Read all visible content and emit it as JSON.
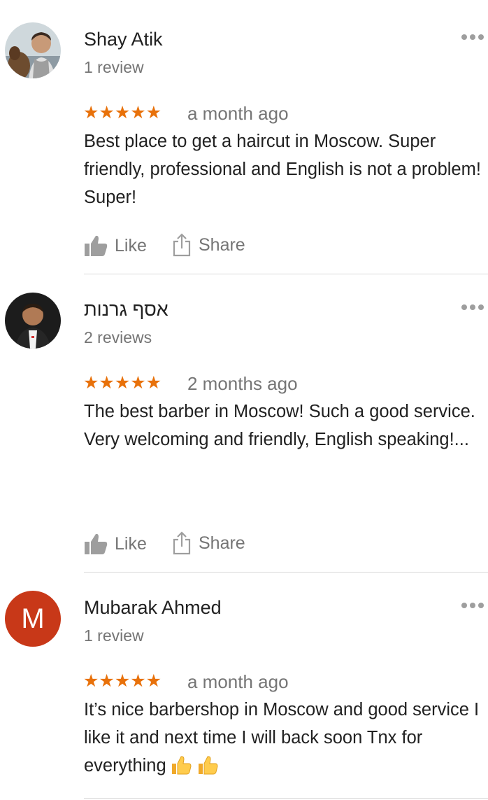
{
  "reviews": [
    {
      "name": "Shay Atik",
      "review_count": "1 review",
      "rating": 5,
      "stars": "★★★★★",
      "time": "a month ago",
      "text": "Best place to get a haircut in Moscow. Super friendly, professional and English is not a problem! Super!",
      "avatar_icon": "photo-avatar"
    },
    {
      "name": "אסף גרנות",
      "review_count": "2 reviews",
      "rating": 5,
      "stars": "★★★★★",
      "time": "2 months ago",
      "text": "The best barber in Moscow! Such a good service. Very welcoming and friendly, English speaking!...",
      "avatar_icon": "photo-avatar"
    },
    {
      "name": "Mubarak Ahmed",
      "review_count": "1 review",
      "rating": 5,
      "stars": "★★★★★",
      "time": "a month ago",
      "text": "It’s nice barbershop in Moscow and good service I like it and next time I will back soon Tnx for everything",
      "avatar_letter": "M",
      "avatar_color": "#c83818"
    }
  ],
  "actions": {
    "like_label": "Like",
    "share_label": "Share"
  },
  "colors": {
    "star": "#e8710a",
    "secondary_text": "#757575",
    "primary_text": "#212121",
    "divider": "#dadada"
  },
  "icons": [
    "thumbs-up-icon",
    "share-icon",
    "more-options-icon",
    "thumbs-up-emoji"
  ]
}
